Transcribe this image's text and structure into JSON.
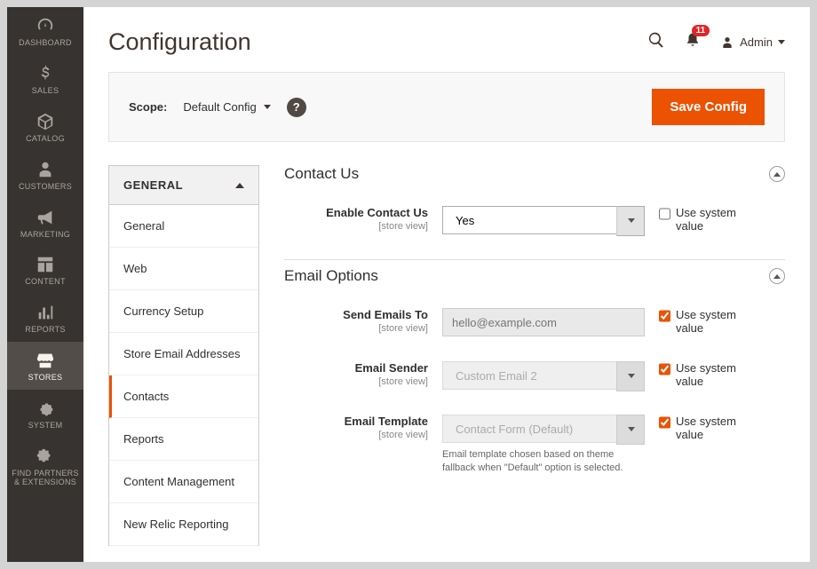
{
  "page": {
    "title": "Configuration"
  },
  "header": {
    "user_label": "Admin",
    "notif_count": "11"
  },
  "scope": {
    "label": "Scope:",
    "value": "Default Config",
    "save_btn": "Save Config"
  },
  "nav": {
    "items": [
      {
        "label": "DASHBOARD"
      },
      {
        "label": "SALES"
      },
      {
        "label": "CATALOG"
      },
      {
        "label": "CUSTOMERS"
      },
      {
        "label": "MARKETING"
      },
      {
        "label": "CONTENT"
      },
      {
        "label": "REPORTS"
      },
      {
        "label": "STORES"
      },
      {
        "label": "SYSTEM"
      },
      {
        "label": "FIND PARTNERS & EXTENSIONS"
      }
    ]
  },
  "tabs": {
    "group_label": "GENERAL",
    "items": [
      {
        "label": "General"
      },
      {
        "label": "Web"
      },
      {
        "label": "Currency Setup"
      },
      {
        "label": "Store Email Addresses"
      },
      {
        "label": "Contacts"
      },
      {
        "label": "Reports"
      },
      {
        "label": "Content Management"
      },
      {
        "label": "New Relic Reporting"
      }
    ]
  },
  "sections": {
    "contact_us": {
      "title": "Contact Us",
      "fields": {
        "enable": {
          "label": "Enable Contact Us",
          "scope": "[store view]",
          "value": "Yes",
          "use_system_label": "Use system value"
        }
      }
    },
    "email_options": {
      "title": "Email Options",
      "fields": {
        "send_to": {
          "label": "Send Emails To",
          "scope": "[store view]",
          "placeholder": "hello@example.com",
          "use_system_label": "Use system value"
        },
        "sender": {
          "label": "Email Sender",
          "scope": "[store view]",
          "value": "Custom Email 2",
          "use_system_label": "Use system value"
        },
        "template": {
          "label": "Email Template",
          "scope": "[store view]",
          "value": "Contact Form (Default)",
          "use_system_label": "Use system value",
          "note": "Email template chosen based on theme fallback when \"Default\" option is selected."
        }
      }
    }
  }
}
